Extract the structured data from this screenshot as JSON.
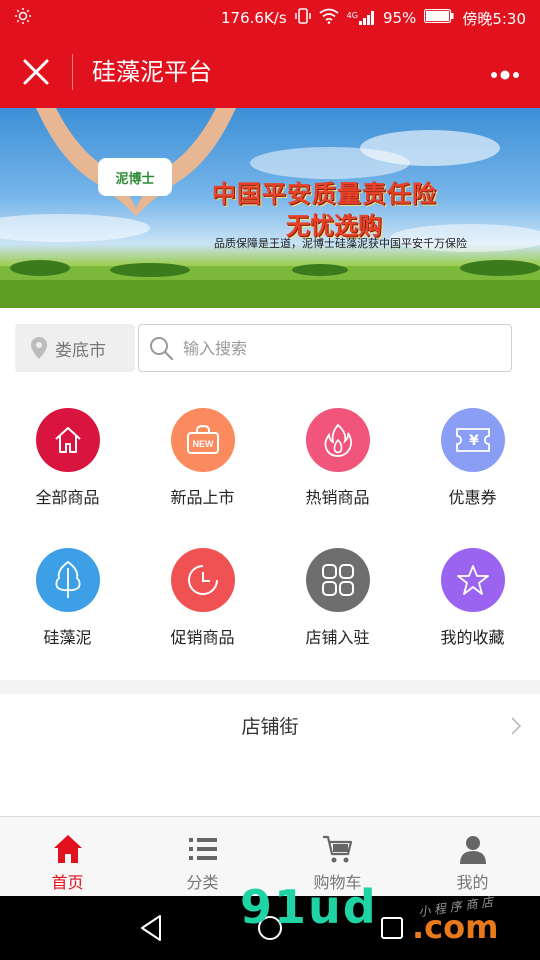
{
  "status_bar": {
    "speed": "176.6K/s",
    "network": "4G",
    "battery": "95%",
    "time": "傍晚5:30"
  },
  "title_bar": {
    "title": "硅藻泥平台",
    "accent_color": "#e2111e"
  },
  "banner": {
    "brand": "泥博士",
    "headline_line1": "中国平安质量责任险",
    "headline_line2": "无忧选购",
    "subtitle": "品质保障是王道，泥博士硅藻泥获中国平安千万保险"
  },
  "search": {
    "city": "娄底市",
    "placeholder": "输入搜索",
    "value": ""
  },
  "categories": [
    {
      "label": "全部商品",
      "icon": "home-icon",
      "color": "#d9143e"
    },
    {
      "label": "新品上市",
      "icon": "new-bag-icon",
      "color": "#fb8a5e"
    },
    {
      "label": "热销商品",
      "icon": "flame-icon",
      "color": "#f2557c"
    },
    {
      "label": "优惠券",
      "icon": "coupon-icon",
      "color": "#8b9ef5"
    },
    {
      "label": "硅藻泥",
      "icon": "leaf-icon",
      "color": "#3da0e6"
    },
    {
      "label": "促销商品",
      "icon": "clock-icon",
      "color": "#f05254"
    },
    {
      "label": "店铺入驻",
      "icon": "grid-icon",
      "color": "#6e6e6e"
    },
    {
      "label": "我的收藏",
      "icon": "star-icon",
      "color": "#9a64f0"
    }
  ],
  "shop_street": {
    "label": "店铺街"
  },
  "tabbar": {
    "items": [
      {
        "label": "首页",
        "icon": "home-icon"
      },
      {
        "label": "分类",
        "icon": "list-icon"
      },
      {
        "label": "购物车",
        "icon": "cart-icon"
      },
      {
        "label": "我的",
        "icon": "user-icon"
      }
    ],
    "active_index": 0
  },
  "watermark": {
    "text": "91ud",
    "suffix": ".com",
    "tagline": "小 程 序 商 店"
  }
}
